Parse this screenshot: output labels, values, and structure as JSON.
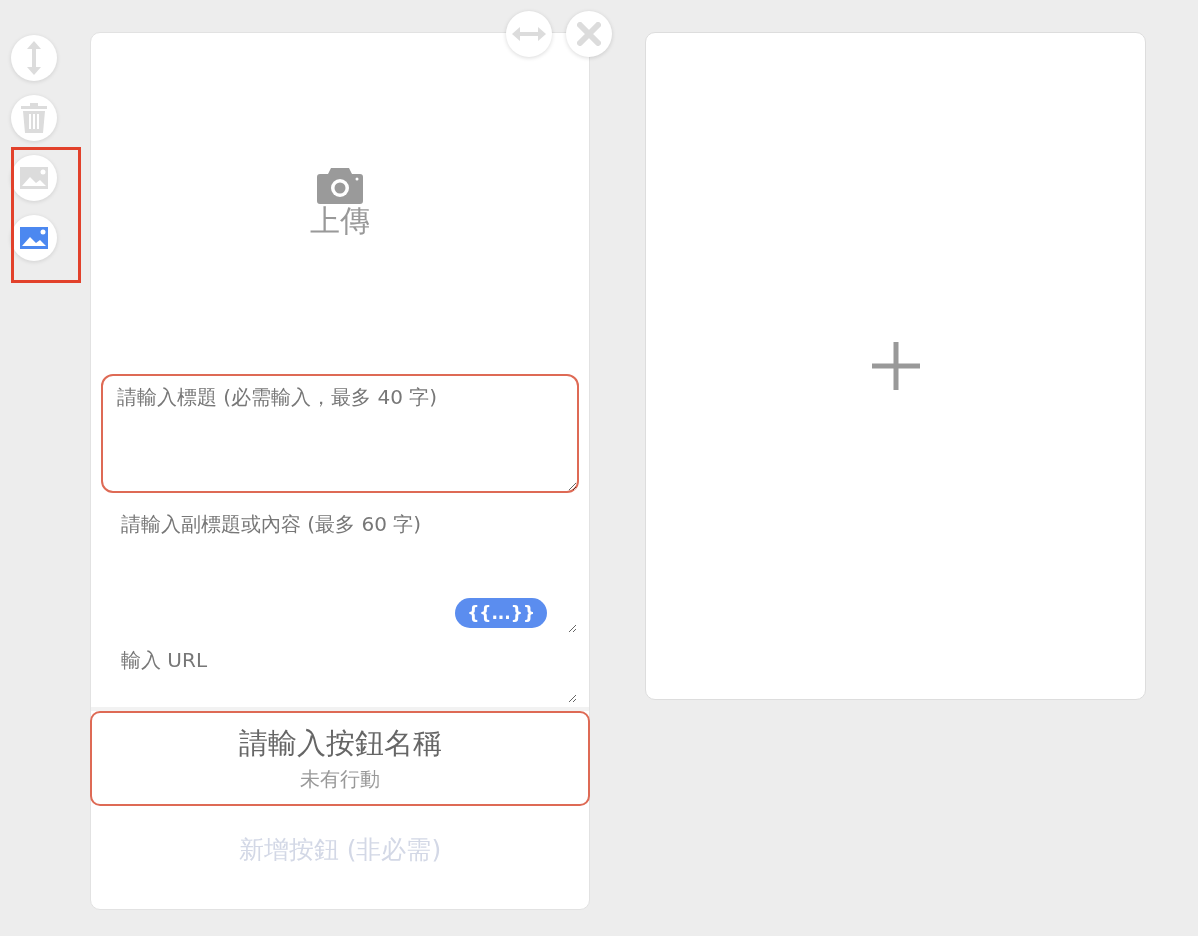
{
  "tools": [
    {
      "kind": "resize",
      "selected": false
    },
    {
      "kind": "delete",
      "selected": false
    },
    {
      "kind": "image",
      "selected": false
    },
    {
      "kind": "image",
      "selected": true
    }
  ],
  "card": {
    "upload": {
      "label": "上傳"
    },
    "title_field": {
      "placeholder": "請輸入標題 (必需輸入，最多 40 字)",
      "error": true
    },
    "subtitle_field": {
      "placeholder": "請輸入副標題或內容 (最多 60 字)",
      "variable_chip": "{{...}}"
    },
    "url_field": {
      "placeholder": "輸入 URL"
    },
    "action_button": {
      "title": "請輸入按鈕名稱",
      "subtitle": "未有行動",
      "error": true
    },
    "add_button": {
      "label": "新增按鈕 (非必需)",
      "disabled": true
    }
  }
}
